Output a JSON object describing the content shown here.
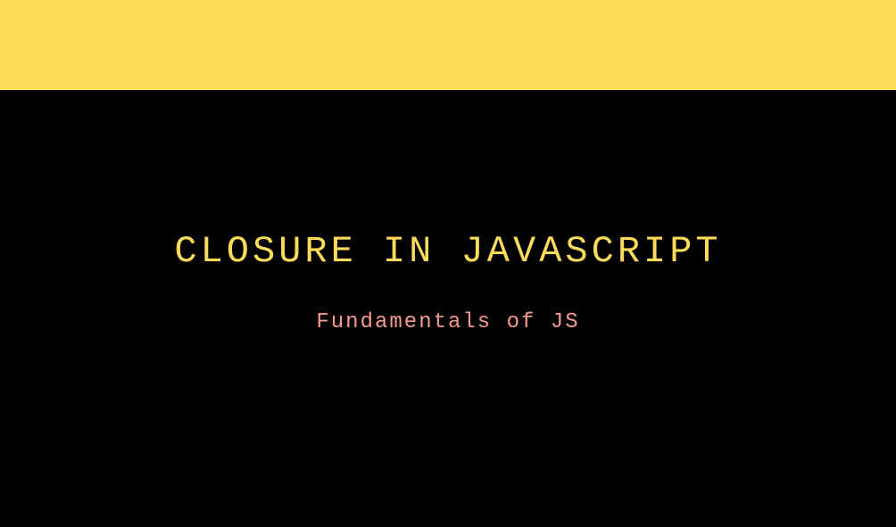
{
  "title": "CLOSURE IN JAVASCRIPT",
  "subtitle": "Fundamentals of JS",
  "colors": {
    "background": "#000000",
    "banner": "#fcdc5a",
    "titleColor": "#fcdc5a",
    "subtitleColor": "#f59a8e"
  }
}
